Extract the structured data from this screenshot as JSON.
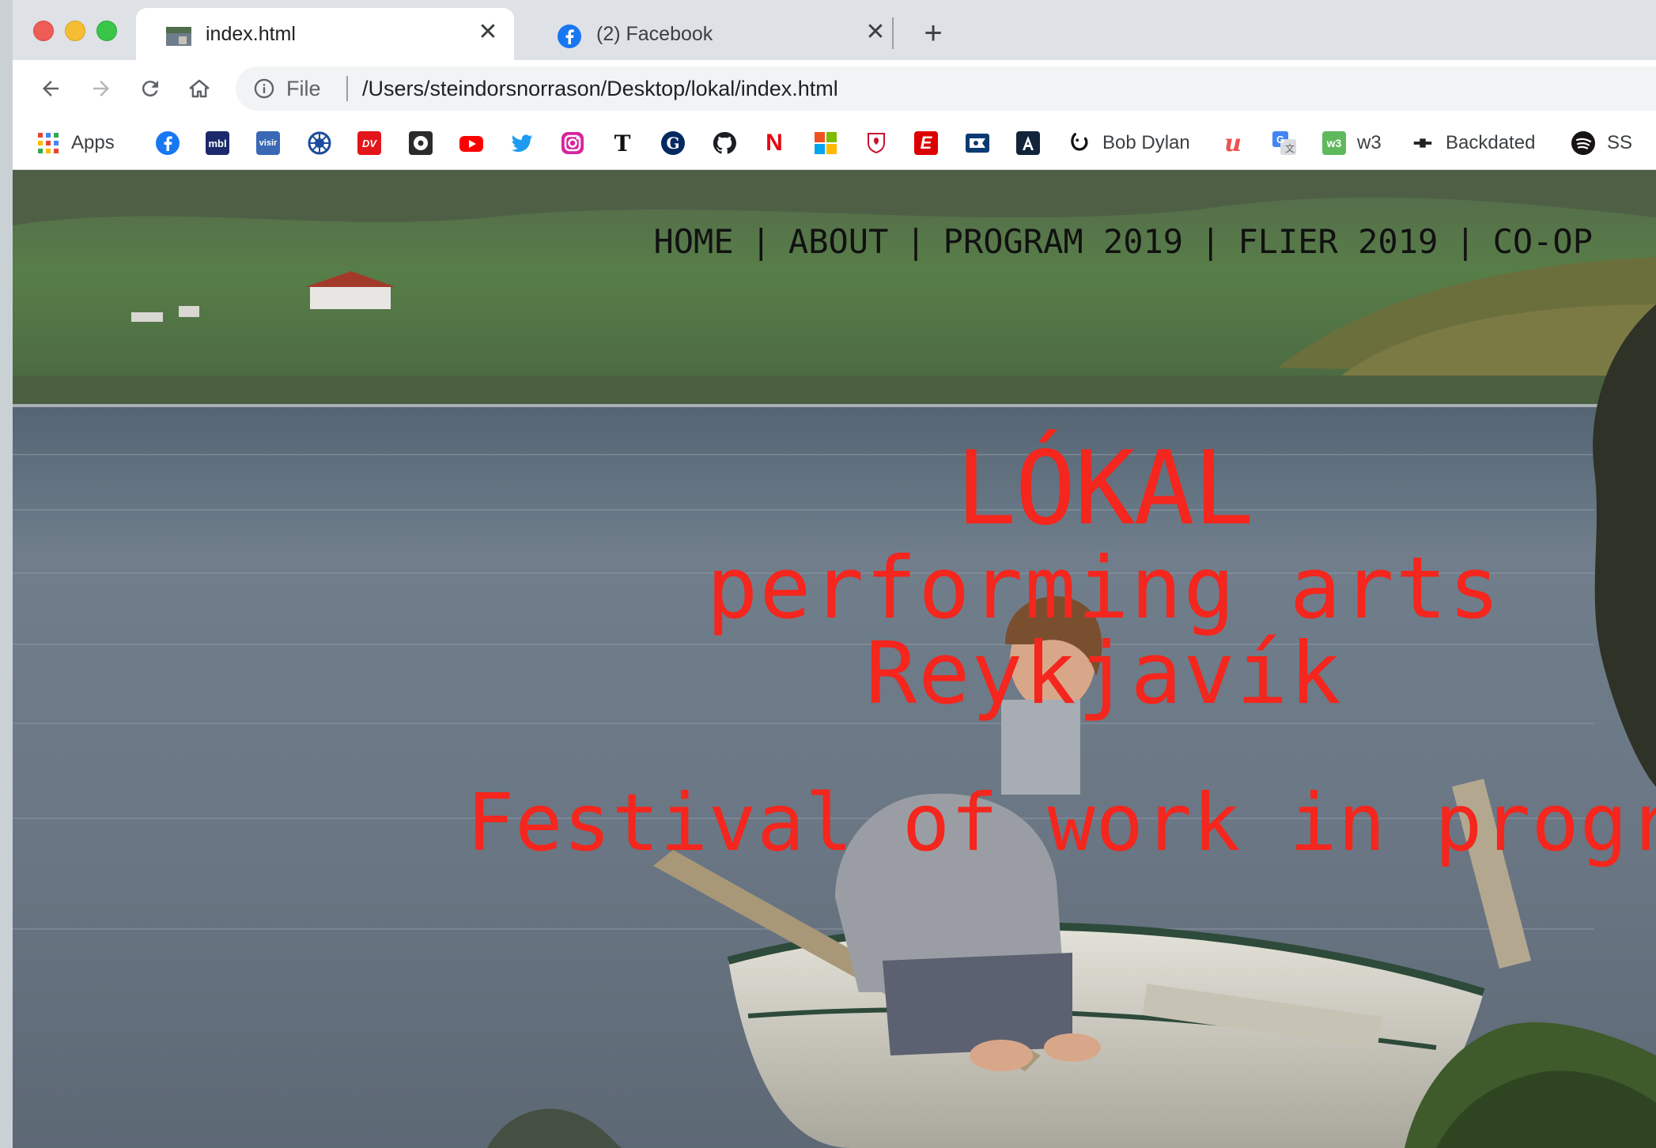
{
  "browser": {
    "tabs": [
      {
        "title": "index.html",
        "favicon": "landscape-thumbnail-icon",
        "active": true
      },
      {
        "title": "(2) Facebook",
        "favicon": "facebook-icon",
        "active": false
      }
    ],
    "address": {
      "scheme": "File",
      "url": "/Users/steindorsnorrason/Desktop/lokal/index.html"
    },
    "bookmarks": [
      {
        "label": "Apps",
        "icon": "apps-grid-icon"
      },
      {
        "label": "",
        "icon": "facebook-icon"
      },
      {
        "label": "",
        "icon": "mbl-icon",
        "badge": "mbl"
      },
      {
        "label": "",
        "icon": "visir-icon",
        "badge": "visir"
      },
      {
        "label": "",
        "icon": "snowflake-icon"
      },
      {
        "label": "",
        "icon": "dv-icon",
        "badge": "DV"
      },
      {
        "label": "",
        "icon": "soccer-icon"
      },
      {
        "label": "",
        "icon": "youtube-icon"
      },
      {
        "label": "",
        "icon": "twitter-icon"
      },
      {
        "label": "",
        "icon": "instagram-icon"
      },
      {
        "label": "",
        "icon": "nytimes-icon",
        "badge": "T"
      },
      {
        "label": "",
        "icon": "guardian-icon",
        "badge": "G"
      },
      {
        "label": "",
        "icon": "github-icon"
      },
      {
        "label": "",
        "icon": "netflix-icon",
        "badge": "N"
      },
      {
        "label": "",
        "icon": "microsoft-icon"
      },
      {
        "label": "",
        "icon": "liverpool-icon"
      },
      {
        "label": "",
        "icon": "espn-icon",
        "badge": "E"
      },
      {
        "label": "",
        "icon": "news-icon"
      },
      {
        "label": "",
        "icon": "podcast-icon"
      },
      {
        "label": "Bob Dylan",
        "icon": "bob-dylan-icon"
      },
      {
        "label": "",
        "icon": "udemy-icon",
        "badge": "u"
      },
      {
        "label": "",
        "icon": "google-translate-icon"
      },
      {
        "label": "w3",
        "icon": "w3schools-icon",
        "badge": "w3"
      },
      {
        "label": "Backdated",
        "icon": "backdated-icon"
      },
      {
        "label": "SS",
        "icon": "spotify-icon"
      }
    ]
  },
  "site": {
    "nav": [
      "HOME",
      "ABOUT",
      "PROGRAM 2019",
      "FLIER 2019",
      "CO-OP"
    ],
    "separator": "|",
    "hero": {
      "title": "LÓKAL",
      "subtitle_line1": "performing arts",
      "subtitle_line2": "Reykjavík",
      "tagline": "Festival of work in progress"
    },
    "colors": {
      "accent": "#f4261d",
      "nav_text": "#111111"
    }
  }
}
